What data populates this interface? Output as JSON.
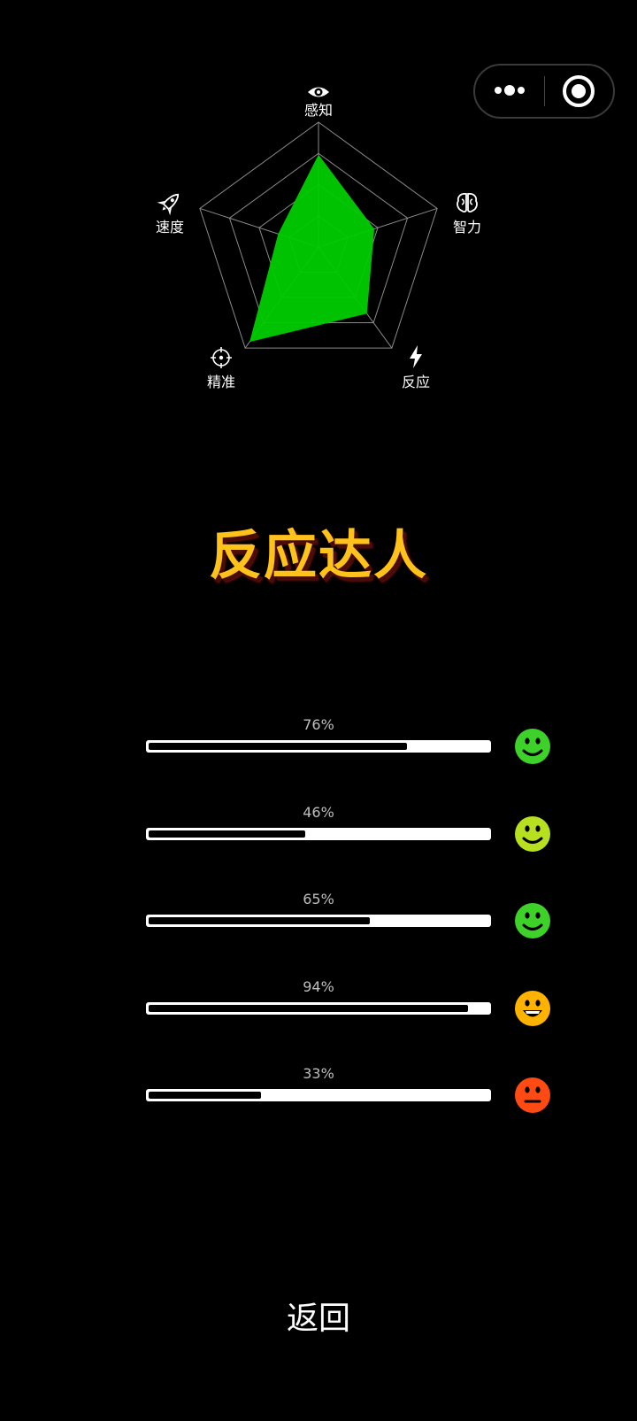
{
  "capsule": {
    "more_icon": "more-dots-icon",
    "close_icon": "target-circle-icon"
  },
  "radar": {
    "axes": [
      {
        "label": "感知",
        "icon": "eye-icon",
        "value": 0.74
      },
      {
        "label": "智力",
        "icon": "brain-icon",
        "value": 0.47
      },
      {
        "label": "反应",
        "icon": "lightning-icon",
        "value": 0.66
      },
      {
        "label": "精准",
        "icon": "crosshair-icon",
        "value": 0.94
      },
      {
        "label": "速度",
        "icon": "rocket-icon",
        "value": 0.34
      }
    ],
    "fill_color": "#00cc00",
    "grid_color": "#8a8a8a",
    "rings": 4
  },
  "title": "反应达人",
  "title_color": "#ffc21a",
  "scores": [
    {
      "percent_label": "76%",
      "fill": 0.76,
      "face": "smile-icon",
      "face_color": "#3ed12a"
    },
    {
      "percent_label": "46%",
      "fill": 0.46,
      "face": "smile-icon",
      "face_color": "#b7e020"
    },
    {
      "percent_label": "65%",
      "fill": 0.65,
      "face": "smile-icon",
      "face_color": "#3ed12a"
    },
    {
      "percent_label": "94%",
      "fill": 0.94,
      "face": "grin-icon",
      "face_color": "#ffb300"
    },
    {
      "percent_label": "33%",
      "fill": 0.33,
      "face": "neutral-face-icon",
      "face_color": "#ff4a14"
    }
  ],
  "back_label": "返回"
}
